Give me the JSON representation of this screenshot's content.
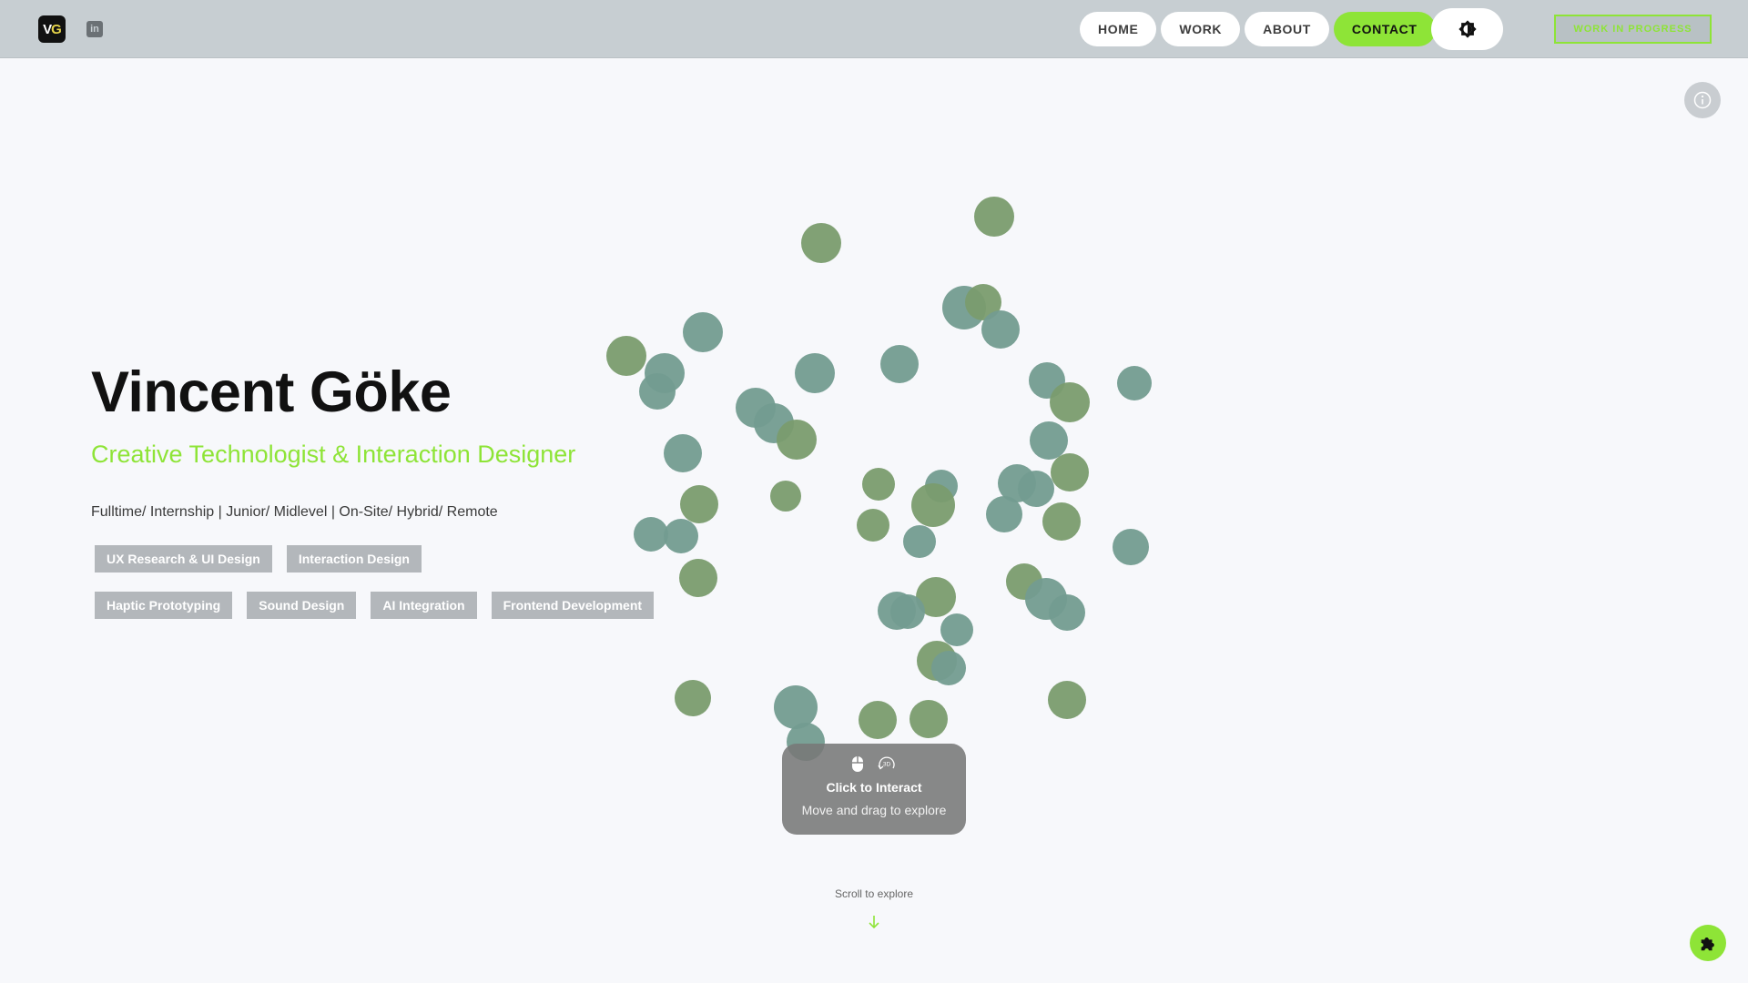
{
  "header": {
    "logo_text_v": "V",
    "logo_text_g": "G",
    "linkedin_label": "in",
    "nav": [
      {
        "label": "HOME"
      },
      {
        "label": "WORK"
      },
      {
        "label": "ABOUT"
      },
      {
        "label": "CONTACT"
      }
    ],
    "wip_label": "WORK IN PROGRESS"
  },
  "hero": {
    "name": "Vincent Göke",
    "role": "Creative Technologist & Interaction Designer",
    "availability": "Fulltime/ Internship | Junior/ Midlevel | On-Site/ Hybrid/ Remote",
    "tags_row1": [
      "UX Research & UI Design",
      "Interaction Design"
    ],
    "tags_row2": [
      "Haptic Prototyping",
      "Sound Design",
      "AI Integration",
      "Frontend Development"
    ]
  },
  "interact_card": {
    "title": "Click to Interact",
    "subtitle": "Move and drag to explore",
    "icon_3d": "3D"
  },
  "scroll_hint": "Scroll to explore",
  "colors": {
    "accent": "#8ee437",
    "header_bg": "#c7ced2",
    "page_bg": "#f7f8fb",
    "particle_green": "#7a9c6e",
    "particle_teal": "#739c90"
  }
}
